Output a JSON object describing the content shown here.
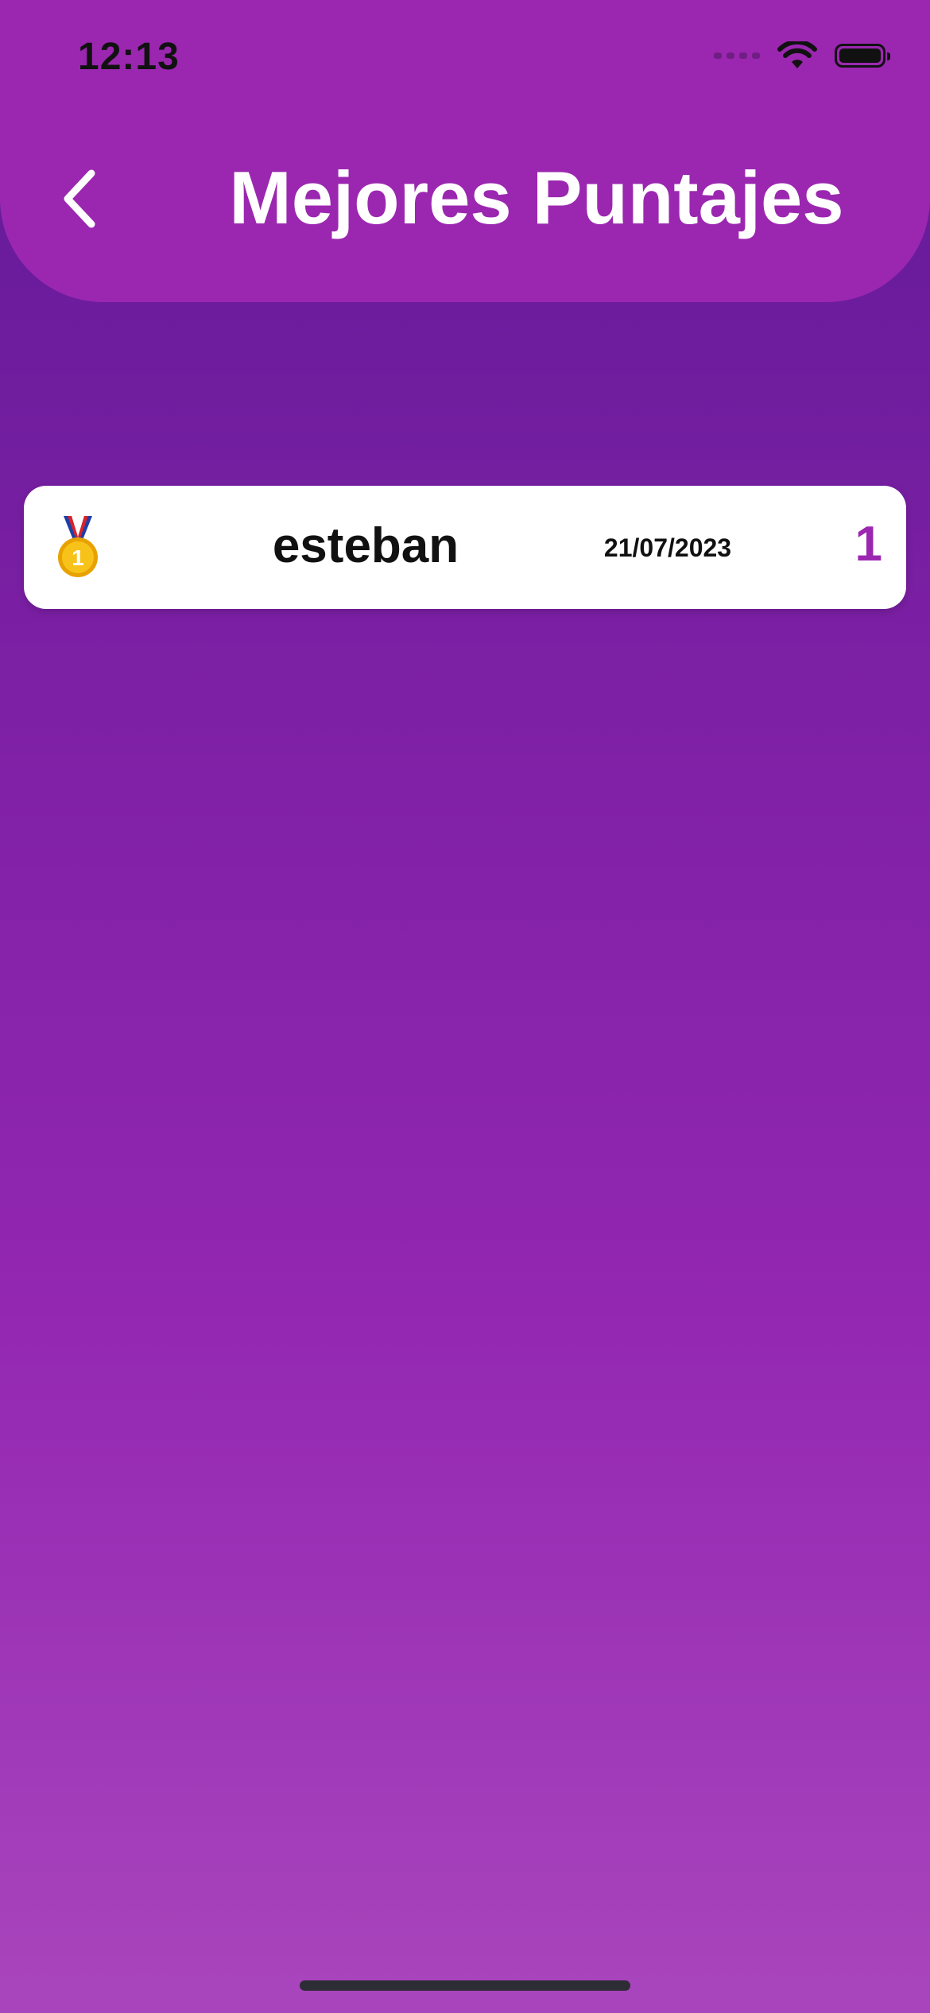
{
  "status_bar": {
    "time": "12:13",
    "icons": [
      "cellular-signal-icon",
      "wifi-icon",
      "battery-icon"
    ]
  },
  "header": {
    "title": "Mejores Puntajes",
    "back_icon": "chevron-left-icon"
  },
  "scores": [
    {
      "medal_icon": "gold-medal-icon",
      "rank": 1,
      "name": "esteban",
      "date": "21/07/2023",
      "score": "1"
    }
  ],
  "colors": {
    "header": "#9B27B0",
    "background_top": "#5E1A96",
    "background_bottom": "#A945BC",
    "card": "#FFFFFF",
    "score_accent": "#9B27B0"
  }
}
